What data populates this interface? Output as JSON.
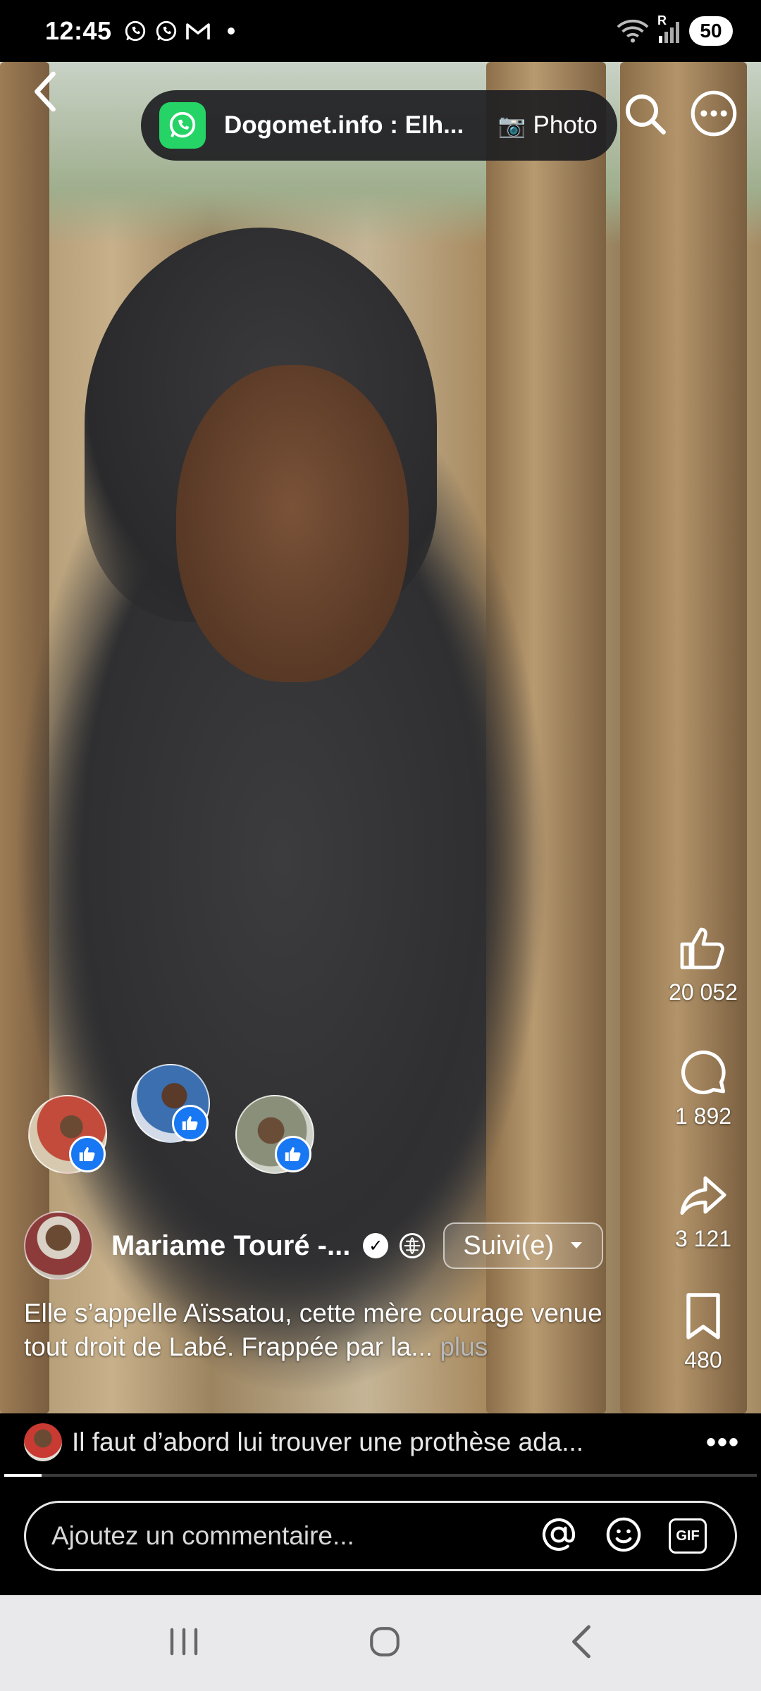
{
  "status_bar": {
    "time": "12:45",
    "battery": "50",
    "left_icons": [
      "whatsapp-icon",
      "whatsapp-business-icon",
      "gmail-icon",
      "dot"
    ],
    "right_icons": [
      "wifi-icon",
      "signal-icon"
    ],
    "signal_label": "R"
  },
  "floating_chat": {
    "app": "whatsapp",
    "title": "Dogomet.info : Elh...",
    "type_emoji": "📷",
    "type_label": "Photo"
  },
  "actions": {
    "likes": "20 052",
    "comments": "1 892",
    "shares": "3 121",
    "saves": "480"
  },
  "post": {
    "author": "Mariame Touré -...",
    "follow_label": "Suivi(e)",
    "caption": "Elle s’appelle Aïssatou, cette mère courage venue tout droit de Labé. Frappée par la...",
    "more_label": "plus"
  },
  "comment_preview": {
    "text": "Il faut d’abord lui trouver une prothèse ada...",
    "more": "•••"
  },
  "comment_bar": {
    "placeholder": "Ajoutez un commentaire...",
    "gif_label": "GIF"
  },
  "progress": 0.05,
  "colors": {
    "whatsapp_green": "#25d366",
    "like_blue": "#1877f2",
    "background": "#000000"
  }
}
